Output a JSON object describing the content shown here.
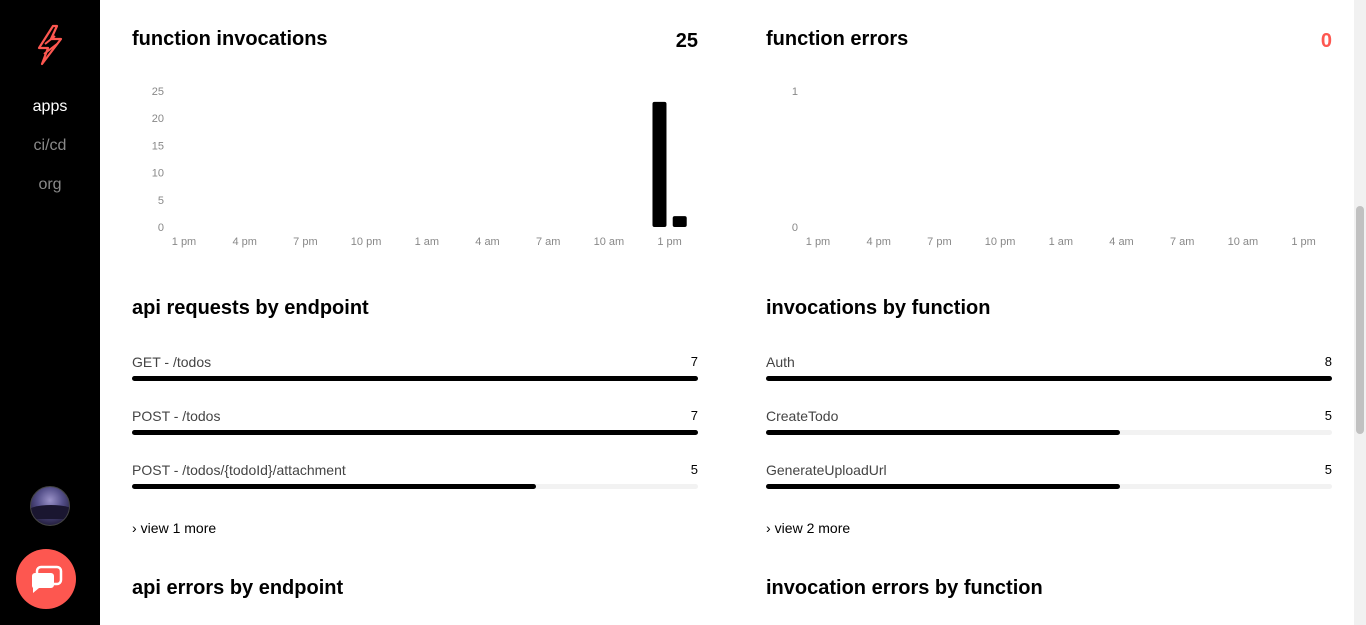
{
  "sidebar": {
    "nav": [
      {
        "label": "apps",
        "active": true
      },
      {
        "label": "ci/cd",
        "active": false
      },
      {
        "label": "org",
        "active": false
      }
    ]
  },
  "invocations": {
    "title": "function invocations",
    "count": "25",
    "chart_data": {
      "type": "bar",
      "x_ticks": [
        "1 pm",
        "4 pm",
        "7 pm",
        "10 pm",
        "1 am",
        "4 am",
        "7 am",
        "10 am",
        "1 pm"
      ],
      "y_ticks": [
        "25",
        "20",
        "15",
        "10",
        "5",
        "0"
      ],
      "ylim": [
        0,
        25
      ],
      "bars": [
        {
          "x_hours": 23.5,
          "value": 23
        },
        {
          "x_hours": 24.5,
          "value": 2
        }
      ]
    }
  },
  "errors": {
    "title": "function errors",
    "count": "0",
    "accent_color": "#fd5750",
    "chart_data": {
      "type": "bar",
      "x_ticks": [
        "1 pm",
        "4 pm",
        "7 pm",
        "10 pm",
        "1 am",
        "4 am",
        "7 am",
        "10 am",
        "1 pm"
      ],
      "y_ticks": [
        "1",
        "0"
      ],
      "ylim": [
        0,
        1
      ],
      "bars": []
    }
  },
  "api_requests": {
    "title": "api requests by endpoint",
    "max": 7,
    "rows": [
      {
        "label": "GET - /todos",
        "value": 7
      },
      {
        "label": "POST - /todos",
        "value": 7
      },
      {
        "label": "POST - /todos/{todoId}/attachment",
        "value": 5
      }
    ],
    "view_more": "view 1 more"
  },
  "invocations_by_function": {
    "title": "invocations by function",
    "max": 8,
    "rows": [
      {
        "label": "Auth",
        "value": 8
      },
      {
        "label": "CreateTodo",
        "value": 5
      },
      {
        "label": "GenerateUploadUrl",
        "value": 5
      }
    ],
    "view_more": "view 2 more"
  },
  "api_errors": {
    "title": "api errors by endpoint"
  },
  "invocation_errors": {
    "title": "invocation errors by function"
  }
}
